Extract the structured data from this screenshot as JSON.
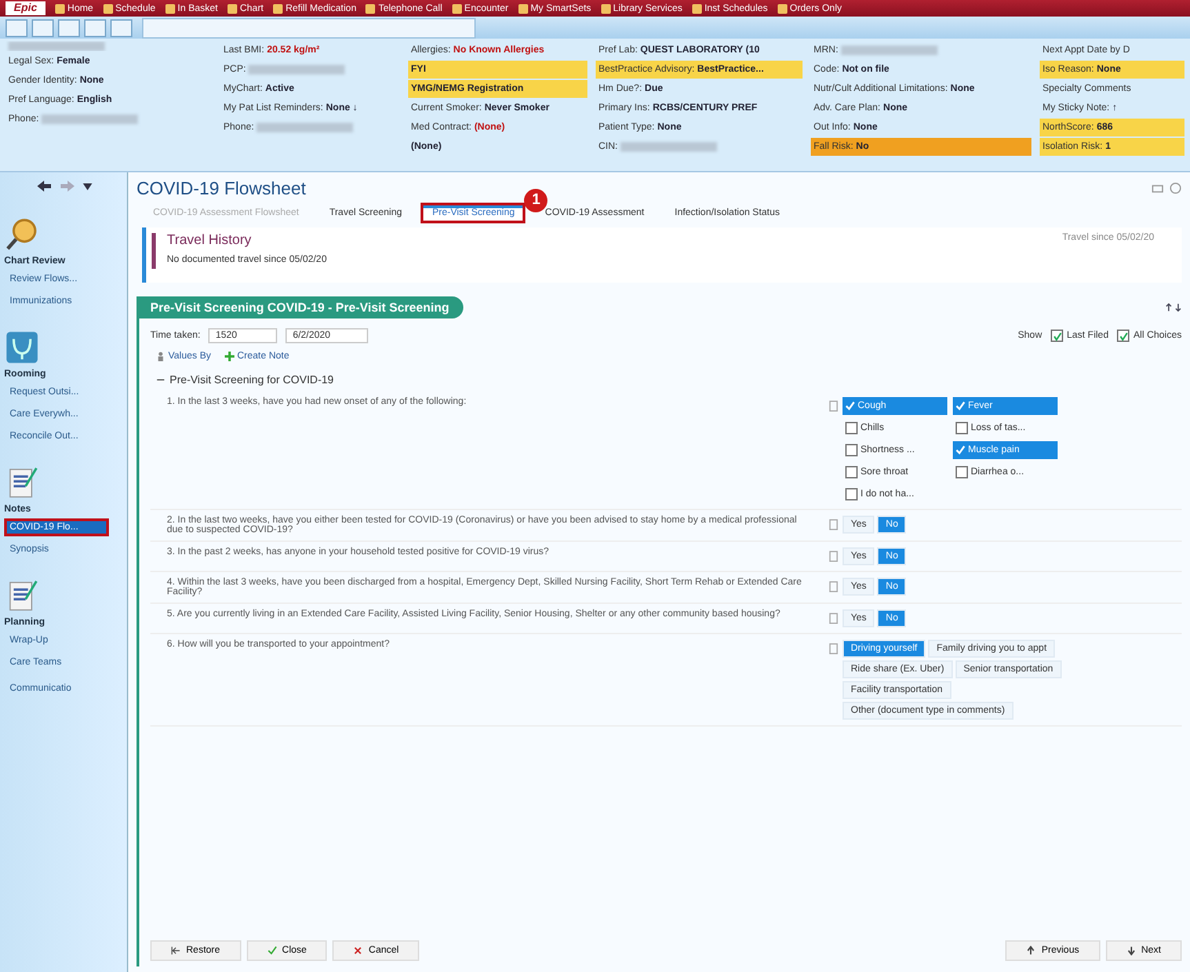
{
  "toolbar": {
    "logo": "Epic",
    "items": [
      "Home",
      "Schedule",
      "In Basket",
      "Chart",
      "Refill Medication",
      "Telephone Call",
      "Encounter",
      "My SmartSets",
      "Library Services",
      "Inst Schedules",
      "Orders Only"
    ]
  },
  "patient_header": {
    "columns": [
      [
        {
          "kind": "redacted"
        },
        {
          "kind": "plain",
          "label": "Legal Sex:",
          "value": "Female"
        },
        {
          "kind": "plain",
          "label": "Gender Identity:",
          "value": "None"
        },
        {
          "kind": "plain",
          "label": "Pref Language:",
          "value": "English"
        },
        {
          "kind": "redacted",
          "label": "Phone:"
        }
      ],
      [
        {
          "kind": "plain",
          "label": "Last BMI:",
          "value": "20.52 kg/m²",
          "alert": true
        },
        {
          "kind": "redacted",
          "label": "PCP:"
        },
        {
          "kind": "plain",
          "label": "MyChart:",
          "value": "Active"
        },
        {
          "kind": "plain",
          "label": "My Pat List Reminders:",
          "value": "None ↓"
        },
        {
          "kind": "redacted",
          "label": "Phone:"
        }
      ],
      [
        {
          "kind": "plain",
          "label": "Allergies:",
          "value": "No Known Allergies",
          "alert": true
        },
        {
          "kind": "flagged",
          "value": "FYI"
        },
        {
          "kind": "flagged",
          "value": "YMG/NEMG Registration"
        },
        {
          "kind": "plain",
          "label": "Current Smoker:",
          "value": "Never Smoker"
        },
        {
          "kind": "plain",
          "label": "Med Contract:",
          "value": "(None)",
          "alert": true
        },
        {
          "kind": "plain",
          "value": "(None)"
        }
      ],
      [
        {
          "kind": "plain",
          "label": "Pref Lab:",
          "value": "QUEST LABORATORY (10"
        },
        {
          "kind": "flagged",
          "label": "BestPractice Advisory:",
          "value": "BestPractice..."
        },
        {
          "kind": "plain",
          "label": "Hm Due?:",
          "value": "Due"
        },
        {
          "kind": "plain",
          "label": "Primary Ins:",
          "value": "RCBS/CENTURY PREF"
        },
        {
          "kind": "plain",
          "label": "Patient Type:",
          "value": "None"
        },
        {
          "kind": "redacted",
          "label": "CIN:"
        }
      ],
      [
        {
          "kind": "redacted",
          "label": "MRN:"
        },
        {
          "kind": "plain",
          "label": "Code:",
          "value": "Not on file"
        },
        {
          "kind": "plain",
          "label": "Nutr/Cult Additional Limitations:",
          "value": "None"
        },
        {
          "kind": "plain",
          "label": "Adv. Care Plan:",
          "value": "None"
        },
        {
          "kind": "plain",
          "label": "Out Info:",
          "value": "None"
        },
        {
          "kind": "critical",
          "label": "Fall Risk:",
          "value": "No"
        }
      ],
      [
        {
          "kind": "plain",
          "label": "Next Appt Date by D"
        },
        {
          "kind": "flagged",
          "label": "Iso Reason:",
          "value": "None"
        },
        {
          "kind": "plain",
          "label": "Specialty Comments"
        },
        {
          "kind": "plain",
          "label": "My Sticky Note:",
          "value": "↑"
        },
        {
          "kind": "flagged",
          "label": "NorthScore:",
          "value": "686"
        },
        {
          "kind": "flagged",
          "label": "Isolation Risk:",
          "value": "1"
        }
      ]
    ]
  },
  "sidebar": {
    "groups": [
      {
        "title": "Chart Review",
        "items": [
          {
            "label": "Review Flows...",
            "selected": false,
            "annotated": false
          },
          {
            "label": "Immunizations",
            "selected": false,
            "annotated": false
          }
        ]
      },
      {
        "title": "Rooming",
        "items": [
          {
            "label": "Request Outsi...",
            "selected": false,
            "annotated": false
          },
          {
            "label": "Care Everywh...",
            "selected": false,
            "annotated": false
          },
          {
            "label": "Reconcile Out...",
            "selected": false,
            "annotated": false
          }
        ]
      },
      {
        "title": "Notes",
        "items": [
          {
            "label": "COVID-19 Flo...",
            "selected": true,
            "annotated": true
          },
          {
            "label": "Synopsis",
            "selected": false,
            "annotated": false
          }
        ]
      },
      {
        "title": "Planning",
        "items": [
          {
            "label": "Wrap-Up",
            "selected": false,
            "annotated": false
          },
          {
            "label": "Care Teams",
            "selected": false,
            "annotated": false
          }
        ]
      },
      {
        "items": [
          {
            "label": "Communicatio",
            "selected": false,
            "annotated": false
          }
        ]
      }
    ]
  },
  "flowsheet": {
    "title": "COVID-19 Flowsheet",
    "tabs": [
      {
        "label": "COVID-19 Assessment Flowsheet",
        "selected": false,
        "disabled": true,
        "annotated": false
      },
      {
        "label": "Travel Screening",
        "selected": false,
        "disabled": false,
        "annotated": false
      },
      {
        "label": "Pre-Visit Screening",
        "selected": true,
        "disabled": false,
        "annotated": true,
        "callout": "1"
      },
      {
        "label": "COVID-19 Assessment",
        "selected": false,
        "disabled": false,
        "annotated": false
      },
      {
        "label": "Infection/Isolation Status",
        "selected": false,
        "disabled": false,
        "annotated": false
      }
    ],
    "travel": {
      "title": "Travel History",
      "text": "No documented travel since 05/02/20",
      "since": "Travel since 05/02/20"
    },
    "section": {
      "title": "Pre-Visit Screening COVID-19 - Pre-Visit Screening",
      "time_label": "Time taken:",
      "time": "1520",
      "date": "6/2/2020",
      "show_label": "Show",
      "show": [
        {
          "label": "Last Filed",
          "checked": true
        },
        {
          "label": "All Choices",
          "checked": true
        }
      ],
      "links": [
        "Values By",
        "Create Note"
      ],
      "group": "Pre-Visit Screening for COVID-19",
      "group_expanded": true,
      "questions": [
        {
          "kind": "multi",
          "text": "1. In the last 3 weeks, have you had new onset of any of the following:",
          "choices": [
            {
              "label": "Cough",
              "checked": true
            },
            {
              "label": "Fever",
              "checked": true
            },
            {
              "label": "Chills",
              "checked": false
            },
            {
              "label": "Loss of tas...",
              "checked": false
            },
            {
              "label": "Shortness ...",
              "checked": false
            },
            {
              "label": "Muscle pain",
              "checked": true
            },
            {
              "label": "Sore throat",
              "checked": false
            },
            {
              "label": "Diarrhea o...",
              "checked": false
            },
            {
              "label": "I do not ha...",
              "checked": false
            }
          ]
        },
        {
          "kind": "single",
          "text": "2. In the last two weeks, have you either been tested for COVID-19 (Coronavirus) or have you been advised to stay home by a medical professional due to suspected COVID-19?",
          "choices": [
            {
              "label": "Yes",
              "selected": false
            },
            {
              "label": "No",
              "selected": true
            }
          ]
        },
        {
          "kind": "single",
          "text": "3. In the past 2 weeks, has anyone in your household tested positive for COVID-19 virus?",
          "choices": [
            {
              "label": "Yes",
              "selected": false
            },
            {
              "label": "No",
              "selected": true
            }
          ]
        },
        {
          "kind": "single",
          "text": "4. Within the last 3 weeks, have you been discharged from a hospital, Emergency Dept, Skilled Nursing Facility, Short Term Rehab or Extended Care Facility?",
          "choices": [
            {
              "label": "Yes",
              "selected": false
            },
            {
              "label": "No",
              "selected": true
            }
          ]
        },
        {
          "kind": "single",
          "text": "5. Are you currently living in an Extended Care Facility, Assisted Living Facility, Senior Housing, Shelter or any other community based housing?",
          "choices": [
            {
              "label": "Yes",
              "selected": false
            },
            {
              "label": "No",
              "selected": true
            }
          ]
        },
        {
          "kind": "single",
          "text": "6. How will you be transported to your appointment?",
          "choices": [
            {
              "label": "Driving yourself",
              "selected": true
            },
            {
              "label": "Family driving you to appt",
              "selected": false
            },
            {
              "label": "Ride share (Ex. Uber)",
              "selected": false
            },
            {
              "label": "Senior transportation",
              "selected": false
            },
            {
              "label": "Facility transportation",
              "selected": false
            },
            {
              "label": "Other (document type in comments)",
              "selected": false
            }
          ]
        }
      ]
    },
    "footer": {
      "left": [
        "Restore",
        "Close",
        "Cancel"
      ],
      "right": [
        "Previous",
        "Next"
      ]
    }
  }
}
